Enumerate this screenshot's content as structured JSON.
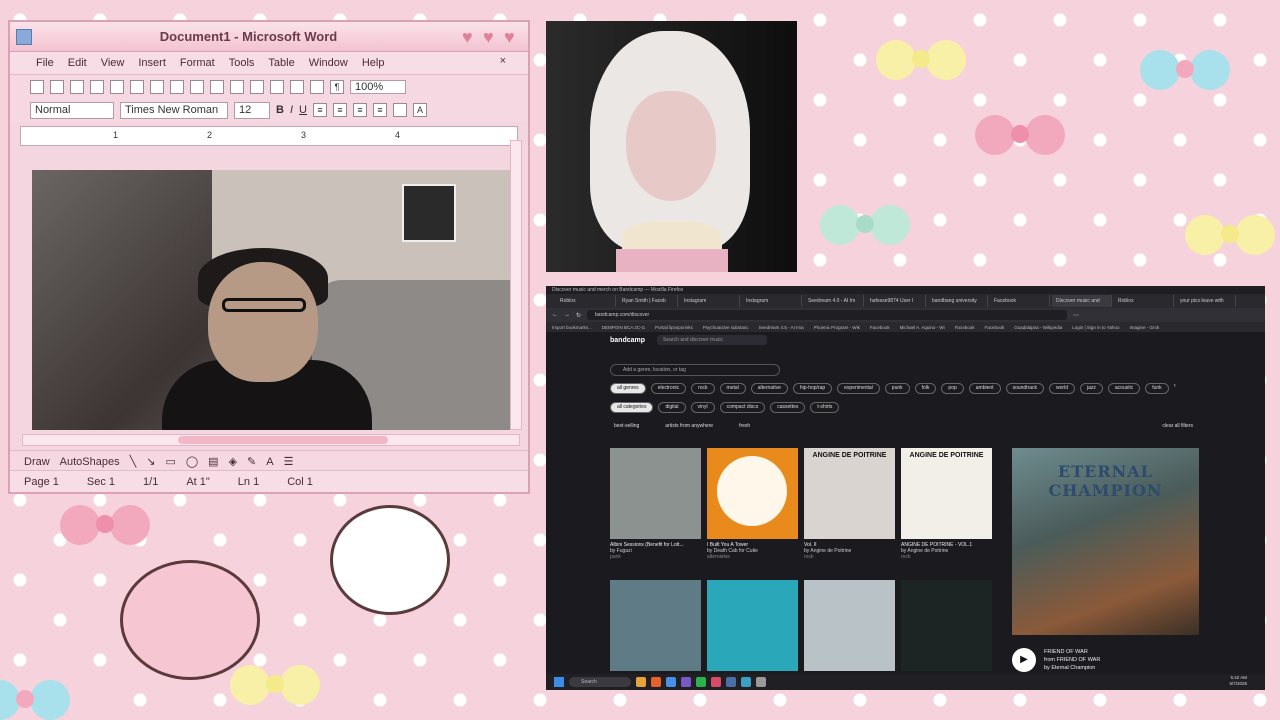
{
  "word": {
    "title": "Document1 - Microsoft Word",
    "menu": [
      "File",
      "Edit",
      "View",
      "Insert",
      "Format",
      "Tools",
      "Table",
      "Window",
      "Help"
    ],
    "close_glyph": "×",
    "zoom": "100%",
    "style": "Normal",
    "font": "Times New Roman",
    "font_size": "12",
    "bold": "B",
    "italic": "I",
    "underline": "U",
    "ruler_marks": [
      "1",
      "2",
      "3",
      "4"
    ],
    "draw_label": "Draw",
    "autoshapes_label": "AutoShapes",
    "status": {
      "page": "Page 1",
      "sec": "Sec 1",
      "pages": "1/1",
      "at": "At 1\"",
      "ln": "Ln 1",
      "col": "Col 1"
    },
    "colors": {
      "frame": "#f3d6df",
      "accent": "#e2809a"
    }
  },
  "browser": {
    "window_title": "Discover music and merch on Bandcamp — Mozilla Firefox",
    "tabs": [
      "Roblox",
      "Ryan Smith | Faceb",
      "Instagram",
      "Instagram",
      "Seedream 4.0 - AI Im",
      "hafesse9874 User I",
      "bandbang university",
      "Facebook",
      "Discover music and",
      "Roblox",
      "your pics leave with"
    ],
    "active_tab": 8,
    "url": "bandcamp.com/discover",
    "bookmarks": [
      "Import bookmarks...",
      "DEMPOIN BCA 2C-G",
      "Portail liposporinks",
      "Psychoactive substanc",
      "Seedream 4.5 - AI Ima",
      "Phoenix Program - Wik",
      "Facebook",
      "Michael A. Aquino - Wi",
      "Facebook",
      "Facebook",
      "Guadalajara - Wikipedia",
      "Login | Sign in to Yahoo",
      "Imagine - Grok"
    ],
    "logo": "bandcamp",
    "search_placeholder": "Search and discover music",
    "genre_search_placeholder": "Add a genre, location, or tag",
    "genres": [
      "all genres",
      "electronic",
      "rock",
      "metal",
      "alternative",
      "hip-hop/rap",
      "experimental",
      "punk",
      "folk",
      "pop",
      "ambient",
      "soundtrack",
      "world",
      "jazz",
      "acoustic",
      "funk"
    ],
    "formats": [
      "all categories",
      "digital",
      "vinyl",
      "compact discs",
      "cassettes",
      "t-shirts"
    ],
    "filters": [
      "best-selling",
      "artists from anywhere",
      "fresh"
    ],
    "clear_filters": "clear all filters",
    "albums": [
      {
        "title": "Albini Sessions (Benefit for Lott...",
        "artist": "by Fugazi",
        "genre": "punk",
        "color": "#8c9290"
      },
      {
        "title": "I Built You A Tower",
        "artist": "by Death Cab for Cutie",
        "genre": "alternative",
        "color": "#e98a1c"
      },
      {
        "title": "Vol. II",
        "artist": "by Angine de Poitrine",
        "genre": "rock",
        "color": "#d9d4cf",
        "art_text": "ANGINE DE POITRINE"
      },
      {
        "title": "ANGINE DE POITRINE - VOL.1",
        "artist": "by Angine de Poitrine",
        "genre": "rock",
        "color": "#f2efe8",
        "art_text": "ANGINE DE POITRINE"
      }
    ],
    "albums_row2": [
      {
        "color": "#5f7b86"
      },
      {
        "color": "#2aa7b8"
      },
      {
        "color": "#b9c2c7"
      },
      {
        "color": "#1d2424"
      }
    ],
    "featured": {
      "art_text": "ETERNAL CHAMPION",
      "track": "FRIEND OF WAR",
      "from": "from FRIEND OF WAR",
      "by": "by Eternal Champion"
    },
    "taskbar": {
      "search": "Search",
      "clock_time": "5:42 AM",
      "clock_date": "5/7/2026"
    }
  }
}
